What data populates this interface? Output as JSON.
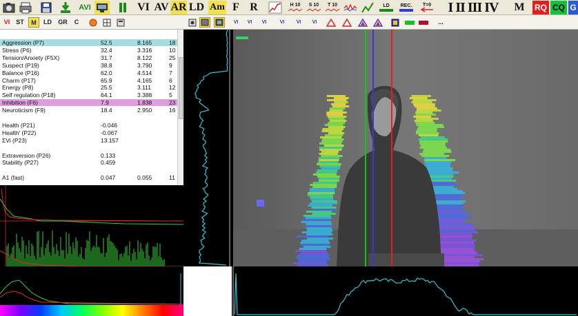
{
  "toolbar1": {
    "avi": "AVI",
    "vi": "VI",
    "av": "AV",
    "ar": "AR",
    "ld": "LD",
    "am": "Am",
    "f": "F",
    "r": "R",
    "h10": "H 10",
    "s10": "S 10",
    "t10": "T 10",
    "ld_small": "LD",
    "rec": "REC.",
    "t0": "T=0",
    "roman": "I II III IV",
    "m": "M",
    "rq": "RQ",
    "cq": "CQ",
    "g": "G"
  },
  "tabs": {
    "vi": "VI",
    "st": "ST",
    "m": "M",
    "ld": "LD",
    "gr": "GR",
    "c": "C",
    "more": "..."
  },
  "toolbar2_buttons": {
    "vi_z1": "VI",
    "vi_z2": "VI",
    "vi_10a": "VI",
    "vi_10b": "VI",
    "vi_n1": "VI",
    "vi_n2": "VI"
  },
  "params": [
    {
      "name": "Aggression (P7)",
      "v1": "52.5",
      "v2": "8.165",
      "v3": "18",
      "hl": "cyan"
    },
    {
      "name": "Stress (P6)",
      "v1": "32.4",
      "v2": "3.316",
      "v3": "10"
    },
    {
      "name": "Tension/Anxiety (F5X)",
      "v1": "31.7",
      "v2": "8.122",
      "v3": "25"
    },
    {
      "name": "Suspect (P19)",
      "v1": "38.8",
      "v2": "3.790",
      "v3": "9"
    },
    {
      "name": "Balance (P16)",
      "v1": "62.0",
      "v2": "4.514",
      "v3": "7"
    },
    {
      "name": "Charm (P17)",
      "v1": "65.9",
      "v2": "4.165",
      "v3": "6"
    },
    {
      "name": "Energy (P8)",
      "v1": "25.5",
      "v2": "3.111",
      "v3": "12"
    },
    {
      "name": "Self regulation (P18)",
      "v1": "64.1",
      "v2": "3.388",
      "v3": "5"
    },
    {
      "name": "Inhibition (F6)",
      "v1": "7.9",
      "v2": "1.838",
      "v3": "23",
      "hl": "pink"
    },
    {
      "name": "Neuroticism (F9)",
      "v1": "18.4",
      "v2": "2.950",
      "v3": "16"
    },
    {
      "name": "",
      "v1": "",
      "v2": "",
      "v3": ""
    },
    {
      "name": "Health (P21)",
      "v1": "-0.046",
      "v2": "",
      "v3": ""
    },
    {
      "name": "Health' (P22)",
      "v1": "-0.067",
      "v2": "",
      "v3": ""
    },
    {
      "name": "ΣVi (P23)",
      "v1": "13.157",
      "v2": "",
      "v3": ""
    },
    {
      "name": "",
      "v1": "",
      "v2": "",
      "v3": ""
    },
    {
      "name": "Extraversion (P26)",
      "v1": "0.133",
      "v2": "",
      "v3": ""
    },
    {
      "name": "Stability (P27)",
      "v1": "0.459",
      "v2": "",
      "v3": ""
    },
    {
      "name": "",
      "v1": "",
      "v2": "",
      "v3": ""
    },
    {
      "name": "A1 (fast)",
      "v1": "0.047",
      "v2": "0.055",
      "v3": "11"
    }
  ],
  "colors": {
    "toolbar": "#ece9d8",
    "highlight_yellow": "#f2e14a",
    "cyan_row": "#a5dde3",
    "pink_row": "#e09ee0",
    "graph_cyan": "#2fc6d6",
    "graph_green": "#39d13a",
    "graph_red": "#e02a2a",
    "vline_green": "#1fbf1f",
    "vline_blue": "#2a3de0",
    "vline_red": "#e02020"
  }
}
